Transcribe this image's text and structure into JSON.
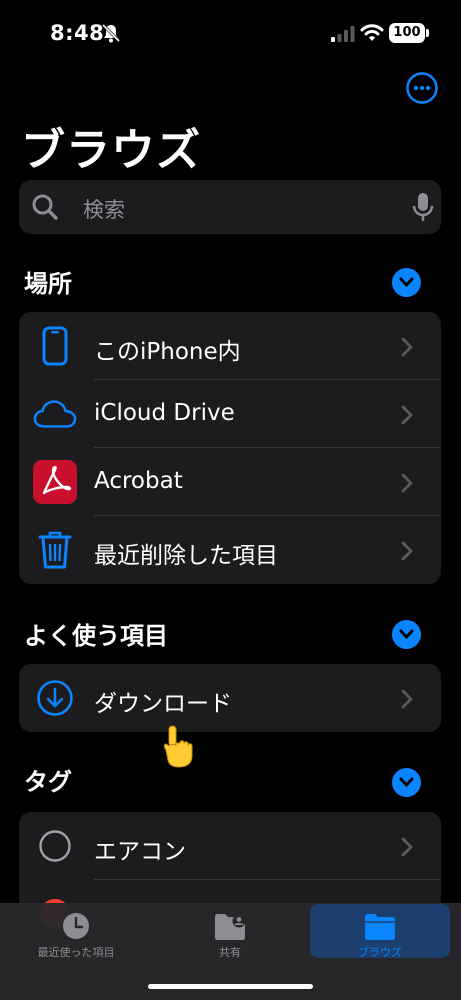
{
  "status_bar": {
    "time": "8:48",
    "battery": "100"
  },
  "header": {
    "title": "ブラウズ"
  },
  "search": {
    "placeholder": "検索"
  },
  "locations": {
    "header": "場所",
    "items": [
      {
        "label": "このiPhone内",
        "icon": "iphone-icon"
      },
      {
        "label": "iCloud Drive",
        "icon": "icloud-icon"
      },
      {
        "label": "Acrobat",
        "icon": "acrobat-icon"
      },
      {
        "label": "最近削除した項目",
        "icon": "trash-icon"
      }
    ]
  },
  "favorites": {
    "header": "よく使う項目",
    "items": [
      {
        "label": "ダウンロード",
        "icon": "download-icon"
      }
    ]
  },
  "tags": {
    "header": "タグ",
    "items": [
      {
        "label": "エアコン",
        "icon": "tag-circle-icon"
      }
    ]
  },
  "tabbar": {
    "tabs": [
      {
        "label": "最近使った項目",
        "icon": "clock-icon"
      },
      {
        "label": "共有",
        "icon": "shared-folder-icon"
      },
      {
        "label": "ブラウズ",
        "icon": "folder-icon",
        "active": true
      }
    ]
  },
  "colors": {
    "accent": "#0a84ff",
    "cell": "#1c1c1e",
    "acrobat": "#c8102e",
    "tag_red": "#ff3b30"
  }
}
